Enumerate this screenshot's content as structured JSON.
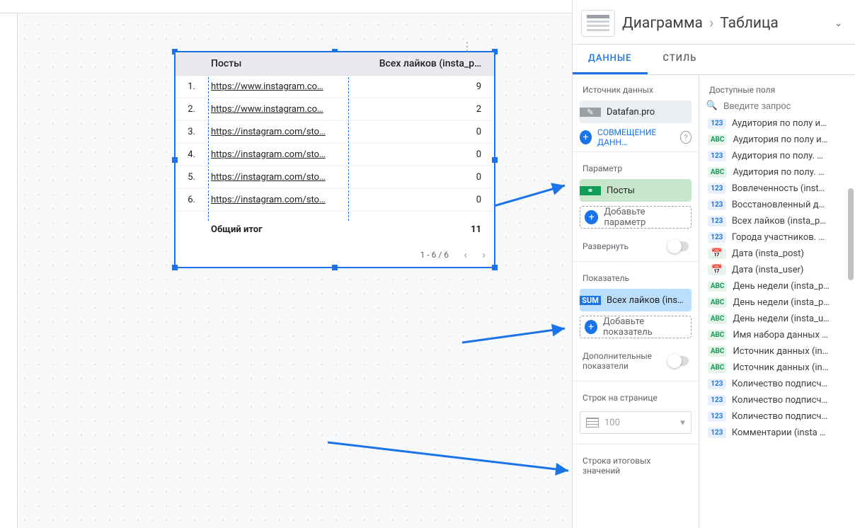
{
  "canvas": {
    "table": {
      "columns": [
        "Посты",
        "Всех лайков (insta_p…"
      ],
      "rows": [
        {
          "idx": "1.",
          "link": "https://www.instagram.co…",
          "val": "9"
        },
        {
          "idx": "2.",
          "link": "https://www.instagram.co…",
          "val": "2"
        },
        {
          "idx": "3.",
          "link": "https://instagram.com/sto…",
          "val": "0"
        },
        {
          "idx": "4.",
          "link": "https://instagram.com/sto…",
          "val": "0"
        },
        {
          "idx": "5.",
          "link": "https://instagram.com/sto…",
          "val": "0"
        },
        {
          "idx": "6.",
          "link": "https://instagram.com/sto…",
          "val": "0"
        }
      ],
      "total_label": "Общий итог",
      "total_value": "11",
      "pager": "1 - 6 / 6"
    }
  },
  "header": {
    "crumb_root": "Диаграмма",
    "crumb_leaf": "Таблица"
  },
  "tabs": {
    "data": "ДАННЫЕ",
    "style": "СТИЛЬ"
  },
  "config": {
    "data_source_label": "Источник данных",
    "data_source_value": "Datafan.pro",
    "blend_label": "СОВМЕЩЕНИЕ ДАНН…",
    "dimension_label": "Параметр",
    "dimension_value": "Посты",
    "add_dimension": "Добавьте параметр",
    "drilldown_label": "Развернуть",
    "metric_label": "Показатель",
    "metric_agg": "SUM",
    "metric_value": "Всех лайков (inst…",
    "add_metric": "Добавьте показатель",
    "opt_metrics_label_1": "Дополнительные",
    "opt_metrics_label_2": "показатели",
    "rows_label": "Строк на странице",
    "rows_value": "100",
    "summary_row_label": "Строка итоговых значений"
  },
  "fields": {
    "header": "Доступные поля",
    "search_placeholder": "Введите запрос",
    "items": [
      {
        "t": "123",
        "n": "Аудитория по полу и…"
      },
      {
        "t": "abc",
        "n": "Аудитория по полу и…"
      },
      {
        "t": "123",
        "n": "Аудитория по полу. …"
      },
      {
        "t": "abc",
        "n": "Аудитория по полу. …"
      },
      {
        "t": "123",
        "n": "Вовлеченность (inst…"
      },
      {
        "t": "123",
        "n": "Восстановленный д…"
      },
      {
        "t": "123",
        "n": "Всех лайков (insta_p…"
      },
      {
        "t": "123",
        "n": "Города участников. …"
      },
      {
        "t": "cal",
        "n": "Дата (insta_post)"
      },
      {
        "t": "cal",
        "n": "Дата (insta_user)"
      },
      {
        "t": "abc",
        "n": "День недели (insta_p…"
      },
      {
        "t": "abc",
        "n": "День недели (insta_p…"
      },
      {
        "t": "abc",
        "n": "День недели (insta_u…"
      },
      {
        "t": "abc",
        "n": "Имя набора данных …"
      },
      {
        "t": "abc",
        "n": "Источник данных (in…"
      },
      {
        "t": "abc",
        "n": "Источник данных (in…"
      },
      {
        "t": "123",
        "n": "Количество подписч…"
      },
      {
        "t": "123",
        "n": "Количество подписч…"
      },
      {
        "t": "123",
        "n": "Количество подписч…"
      },
      {
        "t": "123",
        "n": "Комментарии (insta …"
      }
    ]
  }
}
